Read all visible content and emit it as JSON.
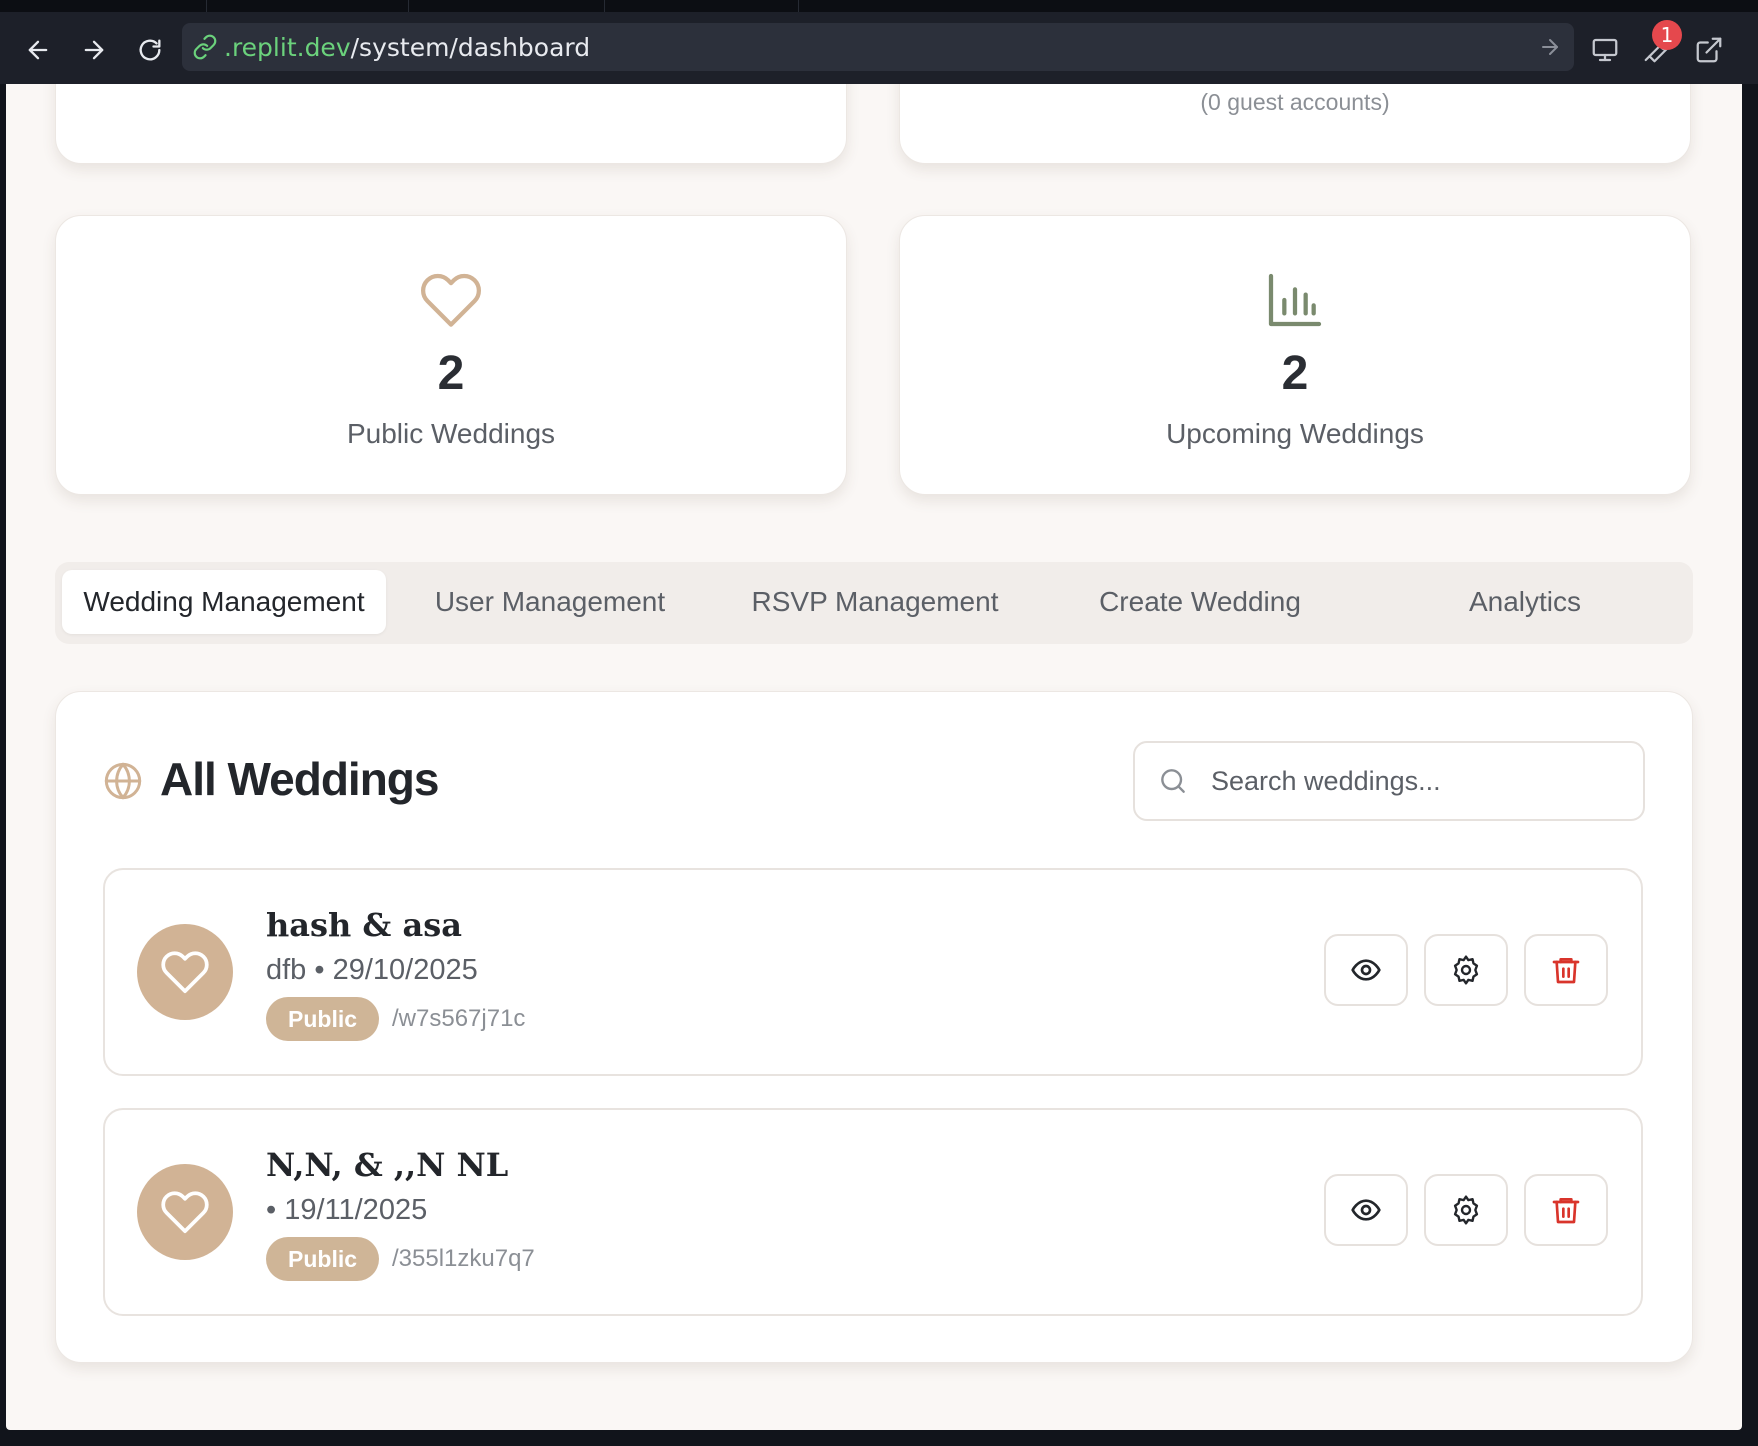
{
  "browser": {
    "url_host": ".replit.dev",
    "url_path": "/system/dashboard",
    "notification_count": "1",
    "icons": [
      "back-icon",
      "forward-icon",
      "reload-icon",
      "link-icon",
      "go-arrow-icon",
      "devices-icon",
      "wrench-icon",
      "external-link-icon"
    ]
  },
  "stats": {
    "top_right_sub": "(0 guest accounts)",
    "public_weddings": {
      "value": "2",
      "label": "Public Weddings"
    },
    "upcoming_weddings": {
      "value": "2",
      "label": "Upcoming Weddings"
    }
  },
  "tabs": [
    {
      "label": "Wedding Management",
      "active": true
    },
    {
      "label": "User Management",
      "active": false
    },
    {
      "label": "RSVP Management",
      "active": false
    },
    {
      "label": "Create Wedding",
      "active": false
    },
    {
      "label": "Analytics",
      "active": false
    }
  ],
  "panel": {
    "title": "All Weddings",
    "search_placeholder": "Search weddings..."
  },
  "weddings": [
    {
      "couple": "hash & asa",
      "meta": "dfb • 29/10/2025",
      "badge": "Public",
      "slug": "/w7s567j71c"
    },
    {
      "couple": "N,N, & ,,N NL",
      "meta": "• 19/11/2025",
      "badge": "Public",
      "slug": "/355l1zku7q7"
    }
  ],
  "colors": {
    "accent_tan": "#cfb597",
    "heart_outline": "#d1b395",
    "chart_icon": "#7a8a6e",
    "delete_red": "#d9342b",
    "url_host_green": "#6bd27c"
  }
}
